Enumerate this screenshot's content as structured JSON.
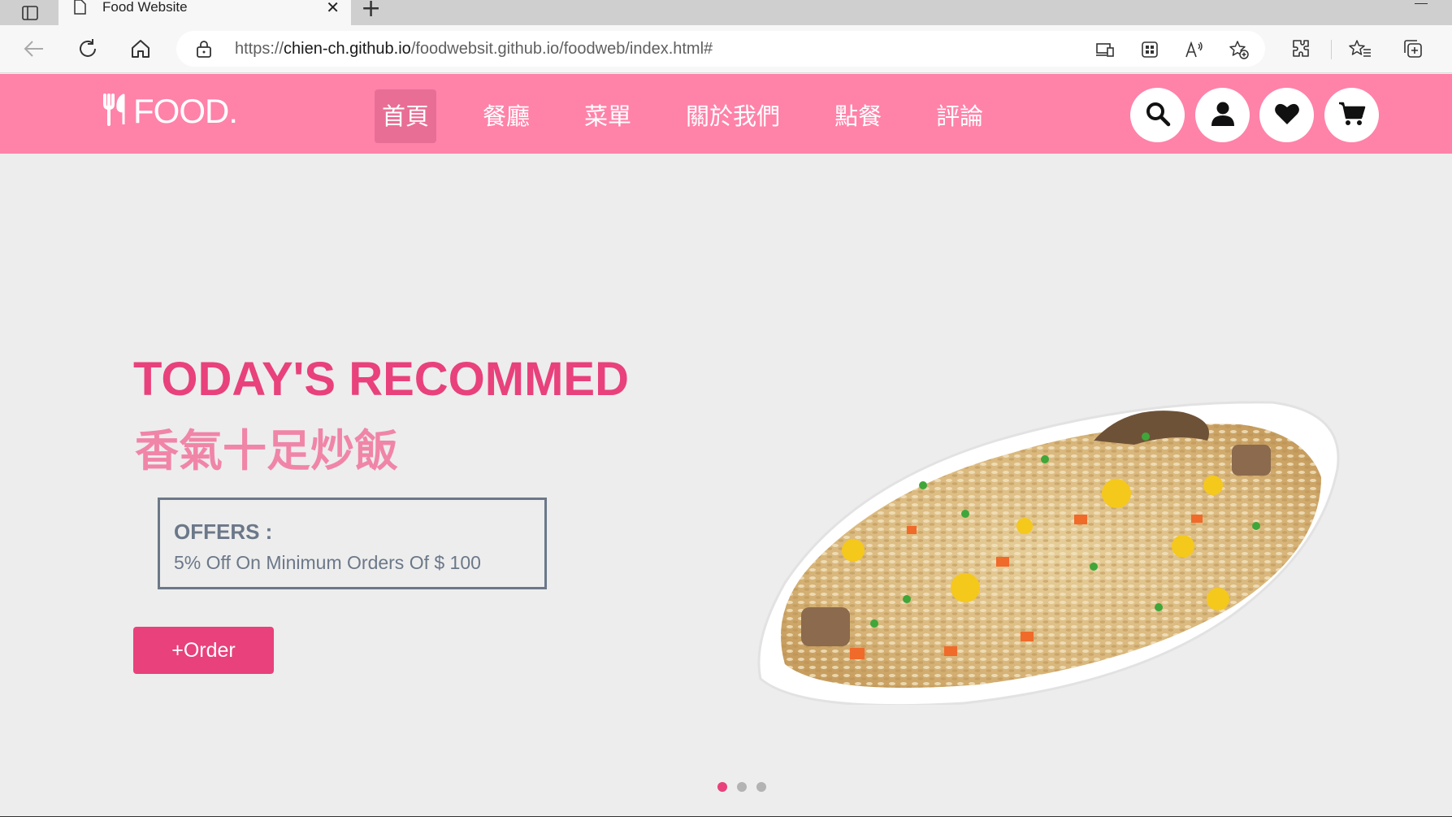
{
  "browser": {
    "tab_title": "Food Website",
    "tab_close": "✕",
    "new_tab": "+",
    "url_prefix": "https://",
    "url_host": "chien-ch.github.io",
    "url_path": "/foodwebsit.github.io/foodweb/index.html#"
  },
  "site": {
    "logo_text": "FOOD.",
    "nav": [
      "首頁",
      "餐廳",
      "菜單",
      "關於我們",
      "點餐",
      "評論"
    ],
    "active_nav": "首頁",
    "header_icons": [
      "search-icon",
      "user-icon",
      "heart-icon",
      "cart-icon"
    ]
  },
  "hero": {
    "title": "TODAY'S RECOMMED",
    "subtitle": "香氣十足炒飯",
    "offer_title": "OFFERS :",
    "offer_text": "5% Off On Minimum Orders Of $ 100",
    "order_button": "+Order",
    "slides": 3,
    "active_slide": 1
  },
  "colors": {
    "header_bg": "#ff82a9",
    "accent": "#e8417b",
    "subtitle": "#f085a8",
    "offer": "#6b7889",
    "page_bg": "#ededed"
  }
}
